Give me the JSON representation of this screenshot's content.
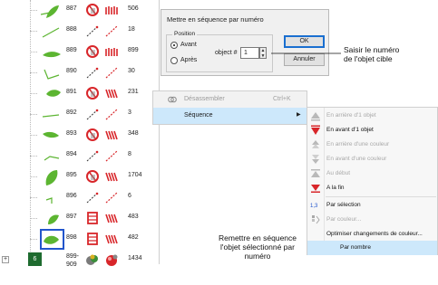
{
  "object_list": {
    "rows": [
      {
        "num": "887",
        "value": "506"
      },
      {
        "num": "888",
        "value": "18"
      },
      {
        "num": "889",
        "value": "899"
      },
      {
        "num": "890",
        "value": "30"
      },
      {
        "num": "891",
        "value": "231"
      },
      {
        "num": "892",
        "value": "3"
      },
      {
        "num": "893",
        "value": "348"
      },
      {
        "num": "894",
        "value": "8"
      },
      {
        "num": "895",
        "value": "1704"
      },
      {
        "num": "896",
        "value": "6"
      },
      {
        "num": "897",
        "value": "483"
      },
      {
        "num": "898",
        "value": "482"
      }
    ],
    "group_row": {
      "badge": "6",
      "num_line1": "899-",
      "num_line2": "909",
      "value": "1434",
      "expand": "+"
    }
  },
  "dialog": {
    "title": "Mettre en séquence par numéro",
    "position_legend": "Position",
    "radio_before": "Avant",
    "radio_after": "Après",
    "object_label": "object #",
    "object_value": "1",
    "ok_button": "OK",
    "cancel_button": "Annuler"
  },
  "callouts": {
    "target_line1": "Saisir le numéro",
    "target_line2": "de l'objet cible",
    "reorder_line1": "Remettre en séquence",
    "reorder_line2": "l'objet sélectionné par",
    "reorder_line3": "numéro"
  },
  "context_menu": {
    "items": [
      {
        "label": "Désassembler",
        "shortcut": "Ctrl+K"
      },
      {
        "label": "Séquence",
        "arrow": "▶"
      }
    ]
  },
  "submenu": {
    "items": [
      {
        "label": "En arrière d'1 objet"
      },
      {
        "label": "En avant d'1 objet"
      },
      {
        "label": "En arrière d'une couleur"
      },
      {
        "label": "En avant d'une couleur"
      },
      {
        "label": "Au début"
      },
      {
        "label": "A la fin"
      },
      {
        "label": "Par sélection"
      },
      {
        "label": "Par couleur..."
      },
      {
        "label": "Optimiser changements de couleur..."
      },
      {
        "label": "Par nombre"
      }
    ]
  },
  "colors": {
    "selection_blue": "#2255cc",
    "menu_highlight": "#cde8fb",
    "leaf_green": "#5cb531",
    "thread_red": "#d8262a",
    "group_green": "#1e6b2f"
  },
  "icons": [
    "leaf-shape-icon",
    "line-shape-icon",
    "thread-spool-icon",
    "satin-stitch-icon",
    "running-stitch-icon",
    "fill-stitch-icon",
    "ungroup-icon",
    "triangle-up-icon",
    "triangle-down-icon",
    "sort-numbers-icon",
    "color-sort-icon"
  ]
}
